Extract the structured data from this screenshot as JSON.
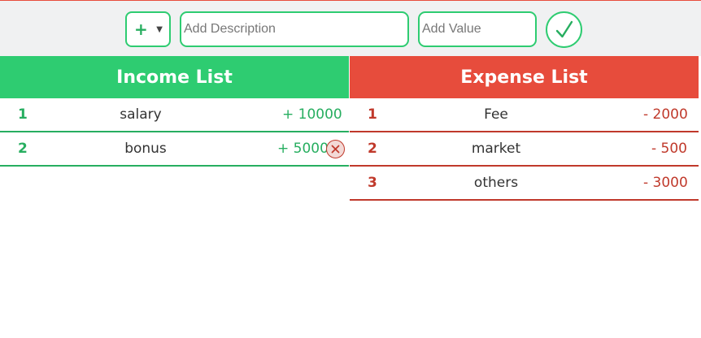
{
  "add_bar": {
    "type_select_value": "+",
    "description_placeholder": "Add Description",
    "value_placeholder": "Add Value",
    "submit_icon": "check-icon"
  },
  "income": {
    "title": "Income List",
    "items": [
      {
        "index": "1",
        "description": "salary",
        "amount": "+ 10000"
      },
      {
        "index": "2",
        "description": "bonus",
        "amount": "+ 5000",
        "delete_icon": "close-circle-icon"
      }
    ]
  },
  "expense": {
    "title": "Expense List",
    "items": [
      {
        "index": "1",
        "description": "Fee",
        "amount": "- 2000"
      },
      {
        "index": "2",
        "description": "market",
        "amount": "- 500"
      },
      {
        "index": "3",
        "description": "others",
        "amount": "- 3000"
      }
    ]
  },
  "colors": {
    "income_green": "#2ecc71",
    "income_text": "#27ae60",
    "expense_red": "#e74c3c",
    "expense_text": "#c0392b"
  }
}
